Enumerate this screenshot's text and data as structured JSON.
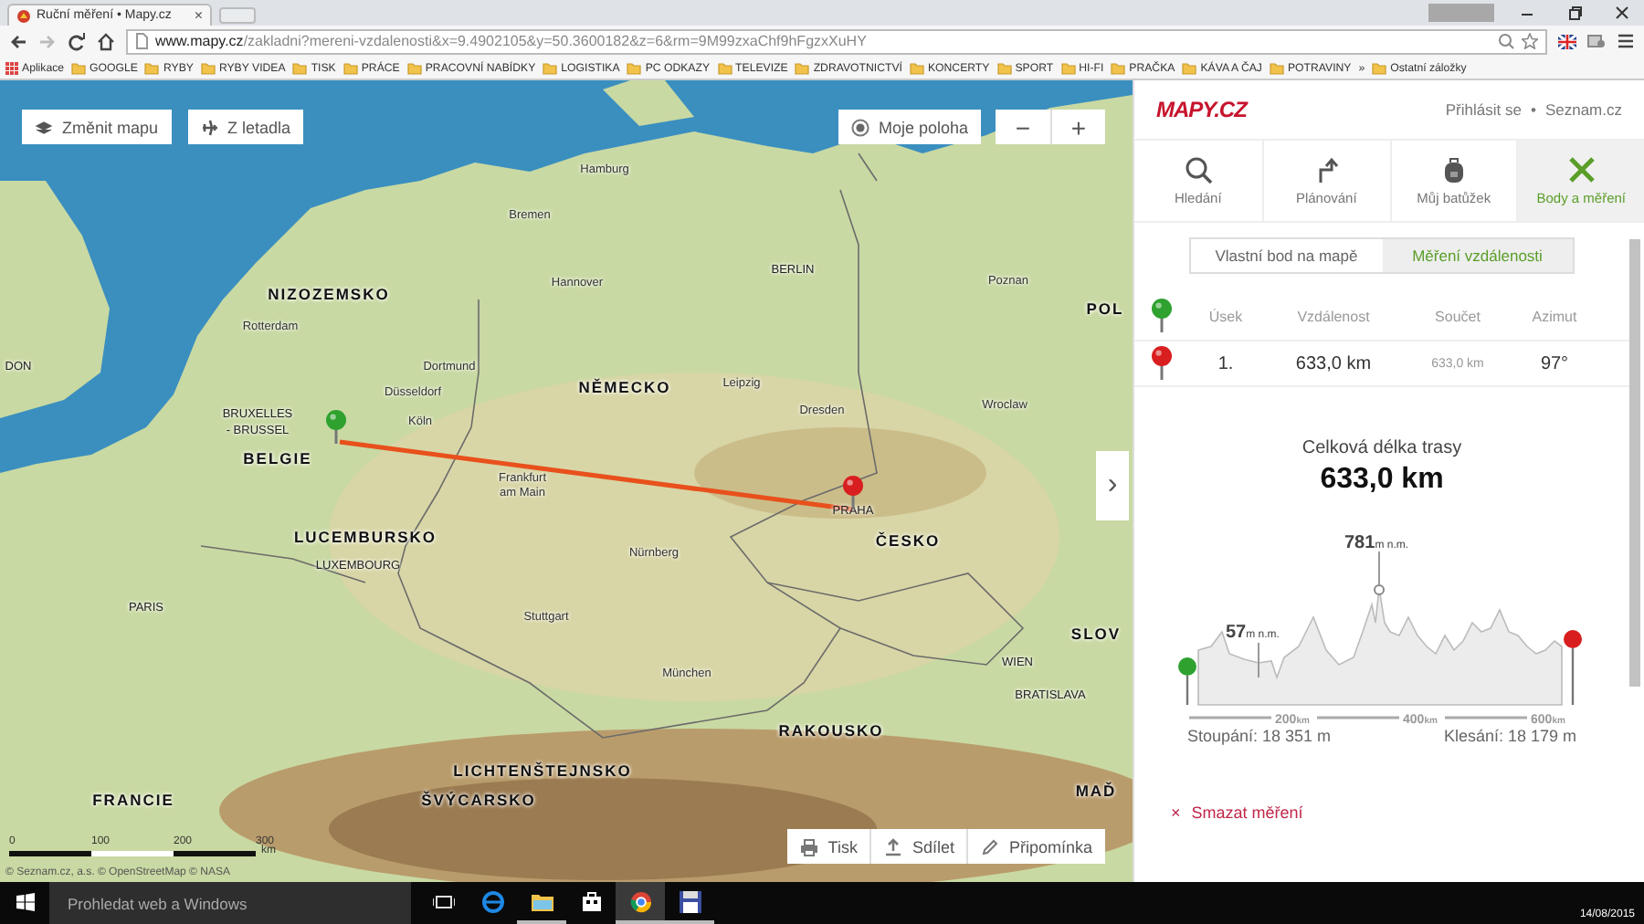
{
  "browser": {
    "tab": {
      "title": "Ruční měření • Mapy.cz",
      "close": "×"
    },
    "url": {
      "host": "www.mapy.cz",
      "path": "/zakladni?mereni-vzdalenosti&x=9.4902105&y=50.3600182&z=6&rm=9M99zxaChf9hFgzxXuHY"
    },
    "bookmarks": [
      {
        "label": "Aplikace",
        "kind": "apps"
      },
      {
        "label": "GOOGLE",
        "kind": "folder"
      },
      {
        "label": "RYBY",
        "kind": "folder"
      },
      {
        "label": "RYBY VIDEA",
        "kind": "folder"
      },
      {
        "label": "TISK",
        "kind": "folder"
      },
      {
        "label": "PRÁCE",
        "kind": "folder"
      },
      {
        "label": "PRACOVNÍ NABÍDKY",
        "kind": "folder"
      },
      {
        "label": "LOGISTIKA",
        "kind": "folder"
      },
      {
        "label": "PC ODKAZY",
        "kind": "folder"
      },
      {
        "label": "TELEVIZE",
        "kind": "folder"
      },
      {
        "label": "ZDRAVOTNICTVÍ",
        "kind": "folder"
      },
      {
        "label": "KONCERTY",
        "kind": "folder"
      },
      {
        "label": "SPORT",
        "kind": "folder"
      },
      {
        "label": "HI-FI",
        "kind": "folder"
      },
      {
        "label": "PRAČKA",
        "kind": "folder"
      },
      {
        "label": "KÁVA A ČAJ",
        "kind": "folder"
      },
      {
        "label": "POTRAVINY",
        "kind": "folder"
      }
    ],
    "more": "»",
    "other": "Ostatní záložky"
  },
  "map": {
    "tools": [
      "Změnit mapu",
      "Z letadla"
    ],
    "my_location": "Moje poloha",
    "zoom_out": "−",
    "zoom_in": "+",
    "expand": "›",
    "labels": [
      {
        "text": "Hamburg",
        "kind": "city"
      },
      {
        "text": "Bremen",
        "kind": "city"
      },
      {
        "text": "Hannover",
        "kind": "city"
      },
      {
        "text": "BERLIN",
        "kind": "capital"
      },
      {
        "text": "Poznan",
        "kind": "city"
      },
      {
        "text": "POL",
        "kind": "country"
      },
      {
        "text": "NIZOZEMSKO",
        "kind": "country"
      },
      {
        "text": "Rotterdam",
        "kind": "city"
      },
      {
        "text": "DON",
        "kind": "capital"
      },
      {
        "text": "Dortmund",
        "kind": "city"
      },
      {
        "text": "Düsseldorf",
        "kind": "city"
      },
      {
        "text": "NĚMECKO",
        "kind": "country"
      },
      {
        "text": "Leipzig",
        "kind": "city"
      },
      {
        "text": "Dresden",
        "kind": "city"
      },
      {
        "text": "Wroclaw",
        "kind": "city"
      },
      {
        "text": "BRUXELLES",
        "kind": "capital"
      },
      {
        "text": "- BRUSSEL",
        "kind": "capital"
      },
      {
        "text": "Köln",
        "kind": "city"
      },
      {
        "text": "BELGIE",
        "kind": "country"
      },
      {
        "text": "Frankfurt",
        "kind": "city"
      },
      {
        "text": "am Main",
        "kind": "city"
      },
      {
        "text": "PRAHA",
        "kind": "capital"
      },
      {
        "text": "LUCEMBURSKO",
        "kind": "country"
      },
      {
        "text": "ČESKO",
        "kind": "country"
      },
      {
        "text": "Nürnberg",
        "kind": "city"
      },
      {
        "text": "LUXEMBOURG",
        "kind": "capital"
      },
      {
        "text": "PARIS",
        "kind": "capital"
      },
      {
        "text": "Stuttgart",
        "kind": "city"
      },
      {
        "text": "SLOV",
        "kind": "country"
      },
      {
        "text": "WIEN",
        "kind": "capital"
      },
      {
        "text": "München",
        "kind": "city"
      },
      {
        "text": "BRATISLAVA",
        "kind": "capital"
      },
      {
        "text": "RAKOUSKO",
        "kind": "country"
      },
      {
        "text": "LICHTENŠTEJNSKO",
        "kind": "country"
      },
      {
        "text": "FRANCIE",
        "kind": "country"
      },
      {
        "text": "ŠVÝCARSKO",
        "kind": "country"
      },
      {
        "text": "MAĎ",
        "kind": "country"
      }
    ],
    "scale": {
      "ticks": [
        "0",
        "100",
        "200",
        "300"
      ],
      "unit": "km"
    },
    "attribution": "© Seznam.cz, a.s. © OpenStreetMap © NASA",
    "actions": [
      "Tisk",
      "Sdílet",
      "Připomínka"
    ]
  },
  "panel": {
    "logo": "MAPY.CZ",
    "login": "Přihlásit se",
    "separator": "•",
    "portal": "Seznam.cz",
    "nav": [
      {
        "label": "Hledání",
        "selected": false
      },
      {
        "label": "Plánování",
        "selected": false
      },
      {
        "label": "Můj batůžek",
        "selected": false
      },
      {
        "label": "Body a měření",
        "selected": true
      }
    ],
    "modes": [
      {
        "label": "Vlastní bod na mapě",
        "selected": false
      },
      {
        "label": "Měření vzdálenosti",
        "selected": true
      }
    ],
    "table": {
      "columns": [
        "Úsek",
        "Vzdálenost",
        "Součet",
        "Azimut"
      ],
      "rows": [
        {
          "cells": [
            "1.",
            "633,0 km",
            "633,0 km",
            "97°"
          ]
        }
      ]
    },
    "total": {
      "label": "Celková délka trasy",
      "value": "633,0 km"
    },
    "profile": {
      "max": {
        "value": "781",
        "unit": "m n.m."
      },
      "min": {
        "value": "57",
        "unit": "m n.m."
      },
      "axis": [
        {
          "value": "200",
          "unit": "km"
        },
        {
          "value": "400",
          "unit": "km"
        },
        {
          "value": "600",
          "unit": "km"
        }
      ]
    },
    "ascent": "Stoupání: 18 351 m",
    "descent": "Klesání: 18 179 m",
    "delete": {
      "icon": "×",
      "label": "Smazat měření"
    }
  },
  "taskbar": {
    "search_placeholder": "Prohledat web a Windows",
    "apps": [
      {
        "running": false,
        "selected": false
      },
      {
        "running": false,
        "selected": false
      },
      {
        "running": true,
        "selected": false
      },
      {
        "running": false,
        "selected": false
      },
      {
        "running": true,
        "selected": true
      },
      {
        "running": true,
        "selected": false
      }
    ],
    "date": "14/08/2015"
  }
}
